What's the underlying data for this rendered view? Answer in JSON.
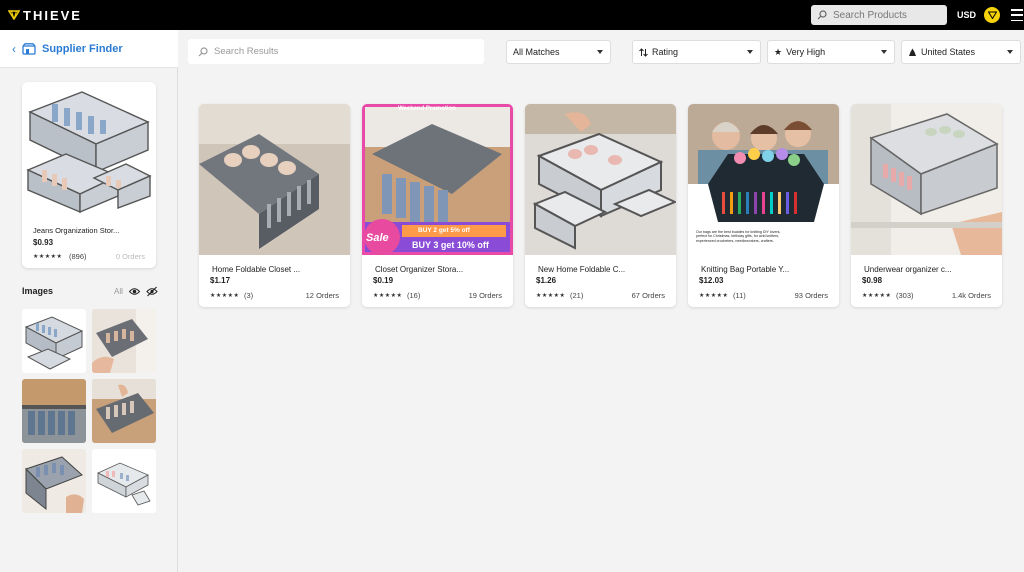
{
  "topbar": {
    "brand": "THIEVE",
    "search_placeholder": "Search Products",
    "currency": "USD"
  },
  "sidebar": {
    "back_glyph": "‹",
    "title": "Supplier Finder",
    "main_product": {
      "title": "Jeans Organization Stor...",
      "price": "$0.93",
      "stars": "★★★★★",
      "reviews": "(896)",
      "orders": "0 Orders"
    },
    "images_label": "Images",
    "all_label": "All"
  },
  "filters": {
    "search_placeholder": "Search Results",
    "matches": "All Matches",
    "sort": "Rating",
    "level": "Very High",
    "country": "United States"
  },
  "products": [
    {
      "title": "Home Foldable Closet ...",
      "price": "$1.17",
      "stars": "★★★★★",
      "reviews": "(3)",
      "orders": "12 Orders"
    },
    {
      "title": "Closet Organizer Stora...",
      "price": "$0.19",
      "stars": "★★★★★",
      "reviews": "(16)",
      "orders": "19 Orders",
      "banner_top": "Weekend Promotion",
      "sale": "Sale",
      "promo1": "BUY 2 get 5% off",
      "promo2": "BUY 3 get 10% off"
    },
    {
      "title": "New Home Foldable C...",
      "price": "$1.26",
      "stars": "★★★★★",
      "reviews": "(21)",
      "orders": "67 Orders"
    },
    {
      "title": "Knitting Bag Portable Y...",
      "price": "$12.03",
      "stars": "★★★★★",
      "reviews": "(11)",
      "orders": "93 Orders",
      "caption": "Our bags are the best buddies for knitting DIY lovers, perfect for Christmas, birthday gifts, for avid knitters, experienced crocheters, needleworkers, crafters."
    },
    {
      "title": "Underwear organizer c...",
      "price": "$0.98",
      "stars": "★★★★★",
      "reviews": "(303)",
      "orders": "1.4k Orders"
    }
  ],
  "colors": {
    "accent": "#2a7bd4",
    "brand_yellow": "#f5d20a",
    "sale_pink": "#e83e8c"
  }
}
